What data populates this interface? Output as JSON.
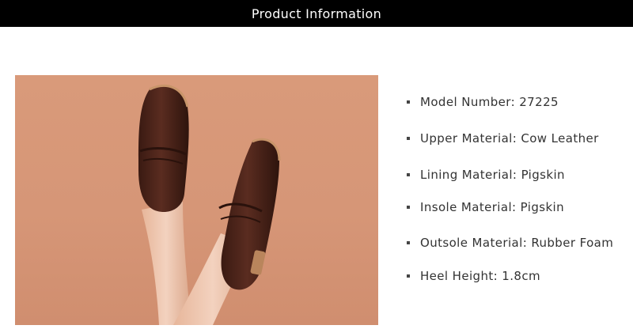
{
  "header": {
    "title": "Product Information"
  },
  "product_specs": [
    {
      "label": "Model Number:",
      "value": "27225"
    },
    {
      "label": "Upper Material:",
      "value": "Cow Leather"
    },
    {
      "label": "Lining Material:",
      "value": "Pigskin"
    },
    {
      "label": "Insole Material:",
      "value": "Pigskin"
    },
    {
      "label": "Outsole Material:",
      "value": "Rubber Foam"
    },
    {
      "label": "Heel Height:",
      "value": "1.8cm"
    }
  ],
  "colors": {
    "header_bg": "#000000",
    "header_text": "#ffffff",
    "photo_bg": "#d99a7a",
    "shoe_leather": "#4a241a",
    "text": "#333333"
  }
}
